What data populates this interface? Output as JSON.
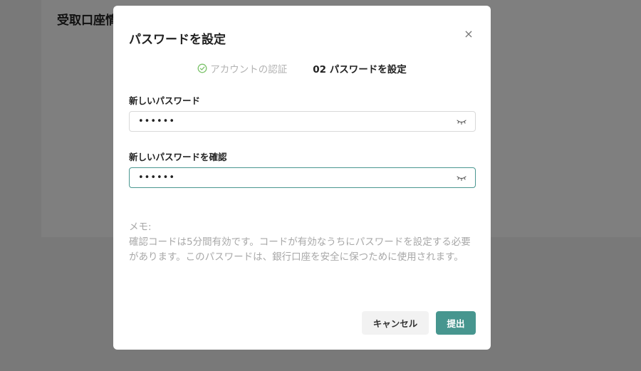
{
  "background": {
    "title": "受取口座情"
  },
  "modal": {
    "title": "パスワードを設定",
    "close_icon": "close-icon",
    "steps": [
      {
        "label": "アカウントの認証",
        "status": "done"
      },
      {
        "label": "02 パスワードを設定",
        "status": "active"
      }
    ],
    "new_password": {
      "label": "新しいパスワード",
      "value": "••••••"
    },
    "confirm_password": {
      "label": "新しいパスワードを確認",
      "value": "••••••"
    },
    "memo": {
      "heading": "メモ:",
      "body": "確認コードは5分間有効です。コードが有効なうちにパスワードを設定する必要があります。このパスワードは、銀行口座を安全に保つために使用されます。"
    },
    "buttons": {
      "cancel": "キャンセル",
      "submit": "提出"
    }
  },
  "colors": {
    "accent": "#47968f",
    "check": "#7cc36b",
    "overlay": "rgba(0,0,0,0.5)"
  }
}
